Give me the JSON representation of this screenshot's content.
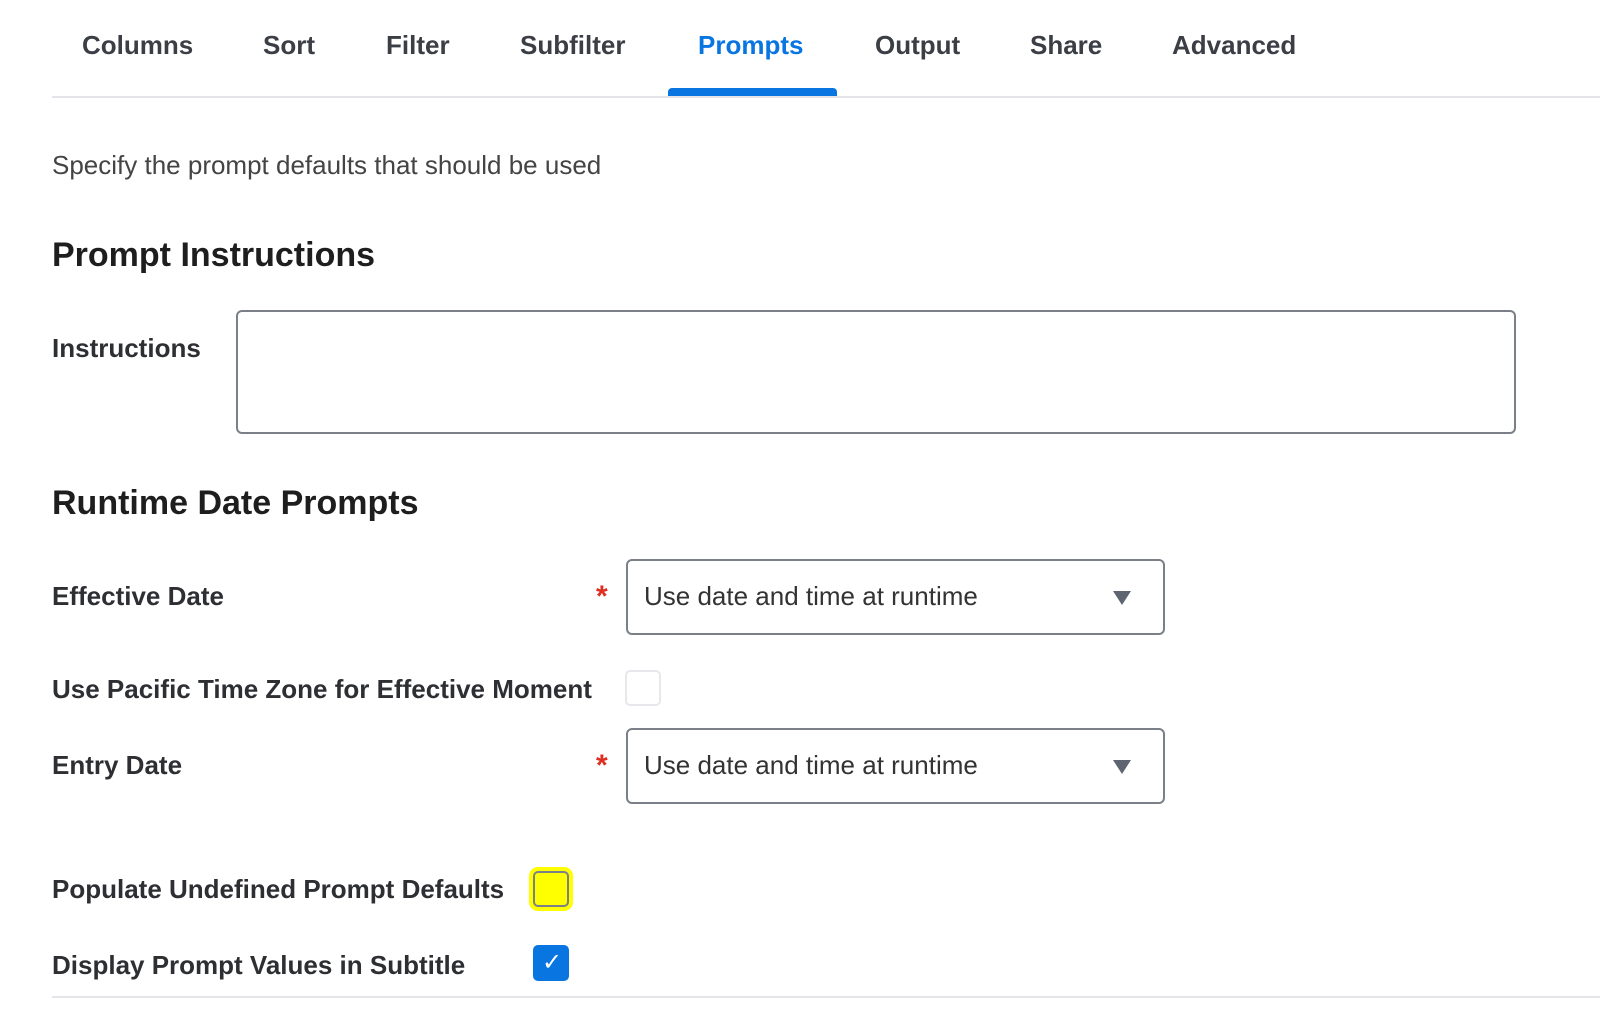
{
  "tabs": [
    {
      "label": "Columns"
    },
    {
      "label": "Sort"
    },
    {
      "label": "Filter"
    },
    {
      "label": "Subfilter"
    },
    {
      "label": "Prompts",
      "active": true
    },
    {
      "label": "Output"
    },
    {
      "label": "Share"
    },
    {
      "label": "Advanced"
    }
  ],
  "intro_text": "Specify the prompt defaults that should be used",
  "prompt_instructions": {
    "title": "Prompt Instructions",
    "instructions_label": "Instructions",
    "instructions_value": ""
  },
  "runtime_date_prompts": {
    "title": "Runtime Date Prompts",
    "effective_date": {
      "label": "Effective Date",
      "required_marker": "*",
      "value": "Use date and time at runtime"
    },
    "pacific_time_zone": {
      "label": "Use Pacific Time Zone for Effective Moment",
      "checked": false
    },
    "entry_date": {
      "label": "Entry Date",
      "required_marker": "*",
      "value": "Use date and time at runtime"
    }
  },
  "populate_undefined": {
    "label": "Populate Undefined Prompt Defaults",
    "checked": false
  },
  "display_prompt_values": {
    "label": "Display Prompt Values in Subtitle",
    "checked": true,
    "check_glyph": "✓"
  },
  "colors": {
    "accent": "#0875e1",
    "required": "#de2e21",
    "highlight": "#ffff00"
  },
  "icons": {
    "select_caret": "chevron-down-icon",
    "checkmark": "check-icon",
    "resize": "resize-grip-icon"
  }
}
